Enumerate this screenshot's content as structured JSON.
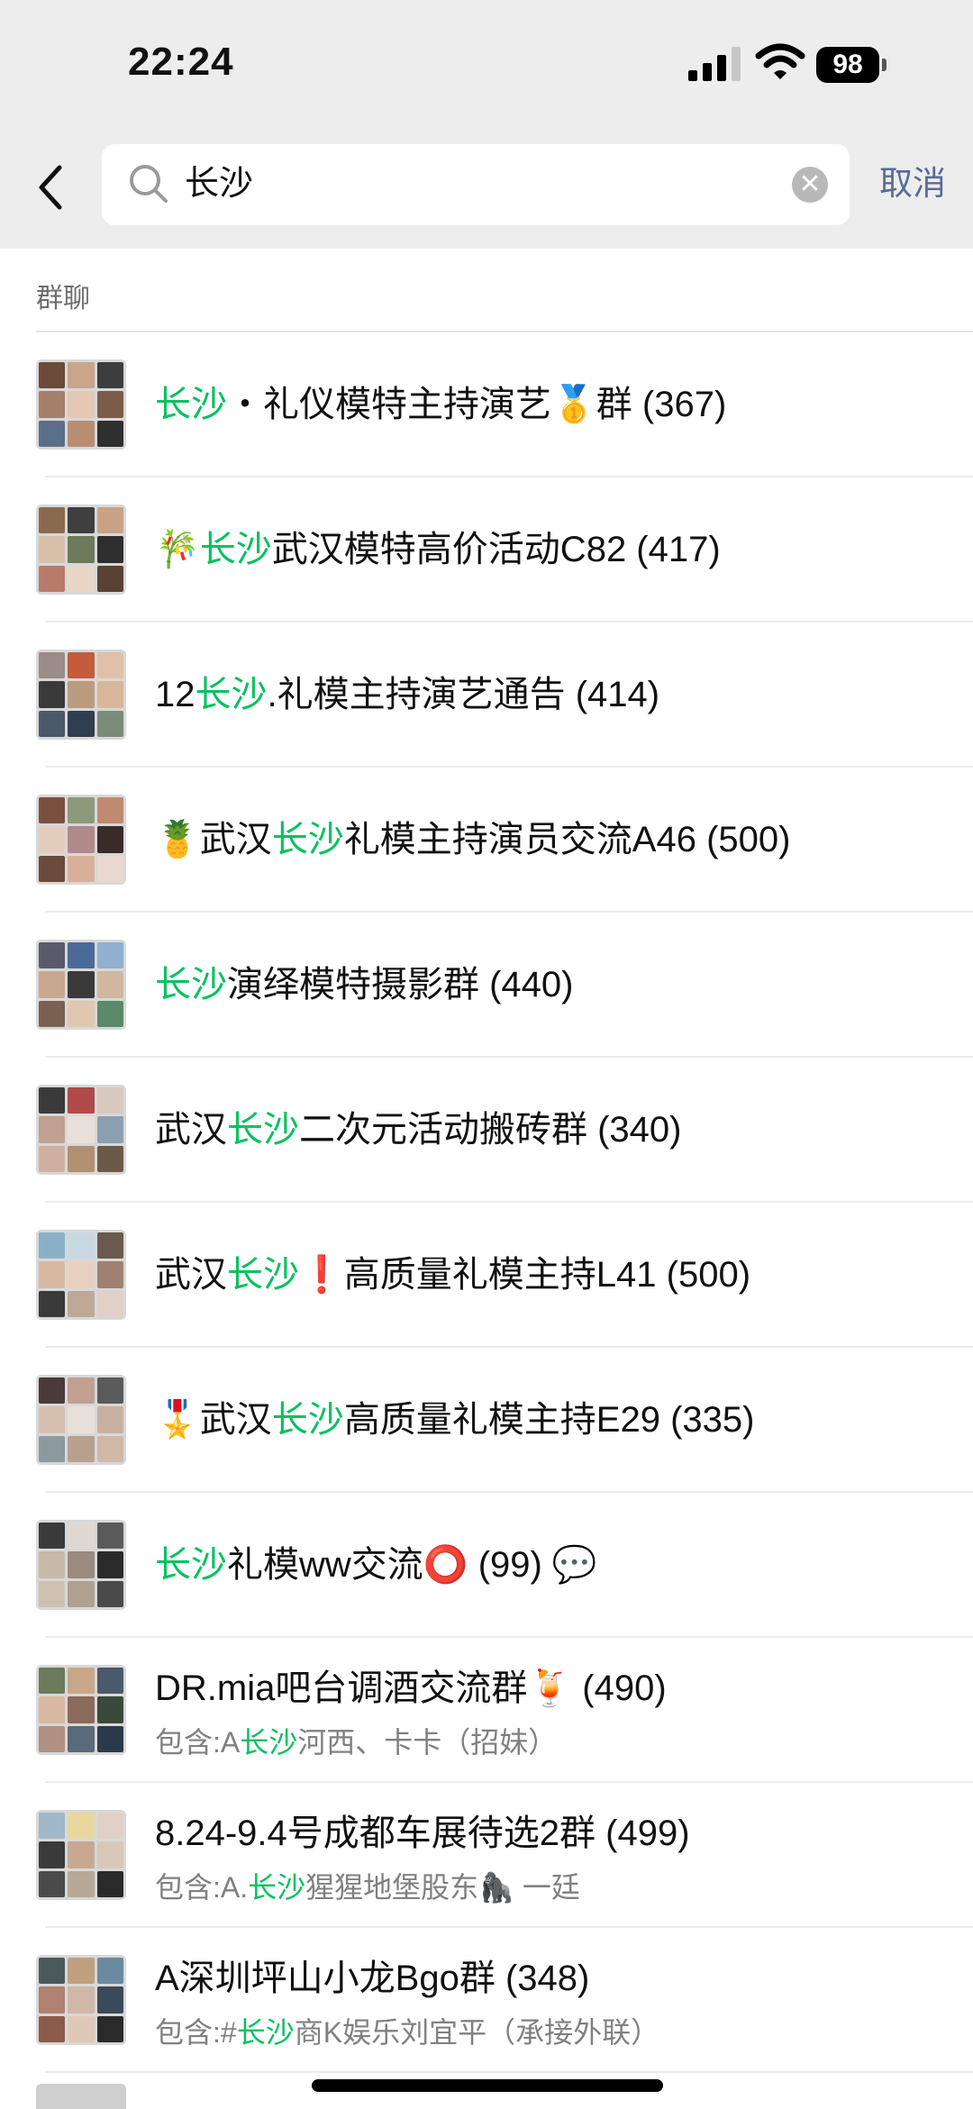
{
  "status_bar": {
    "time": "22:24",
    "battery": "98"
  },
  "search": {
    "query": "长沙",
    "cancel_label": "取消"
  },
  "section": {
    "title": "群聊"
  },
  "results": [
    {
      "title_parts": [
        "",
        "长沙",
        "・礼仪模特主持演艺🥇群 (367)"
      ]
    },
    {
      "title_parts": [
        "🎋",
        "长沙",
        "武汉模特高价活动C82 (417)"
      ]
    },
    {
      "title_parts": [
        "12",
        "长沙",
        ".礼模主持演艺通告 (414)"
      ]
    },
    {
      "title_parts": [
        "🍍武汉",
        "长沙",
        "礼模主持演员交流A46 (500)"
      ]
    },
    {
      "title_parts": [
        "",
        "长沙",
        "演绎模特摄影群 (440)"
      ]
    },
    {
      "title_parts": [
        "武汉",
        "长沙",
        "二次元活动搬砖群 (340)"
      ]
    },
    {
      "title_parts": [
        "武汉",
        "长沙",
        "❗高质量礼模主持L41 (500)"
      ]
    },
    {
      "title_parts": [
        "🎖️武汉",
        "长沙",
        "高质量礼模主持E29 (335)"
      ]
    },
    {
      "title_parts": [
        "",
        "长沙",
        "礼模ww交流⭕ (99) 💬"
      ]
    },
    {
      "title_parts": [
        "DR.mia吧台调酒交流群🍹 (490)",
        "",
        ""
      ],
      "subtitle_parts": [
        "包含:A",
        "长沙",
        "河西、卡卡（招妹）"
      ]
    },
    {
      "title_parts": [
        "8.24-9.4号成都车展待选2群 (499)",
        "",
        ""
      ],
      "subtitle_parts": [
        "包含:A.",
        "长沙",
        "猩猩地堡股东🦍 一廷"
      ]
    },
    {
      "title_parts": [
        "A深圳坪山小龙Bgo群 (348)",
        "",
        ""
      ],
      "subtitle_parts": [
        "包含:#",
        "长沙",
        "商K娱乐刘宜平（承接外联）"
      ]
    }
  ]
}
